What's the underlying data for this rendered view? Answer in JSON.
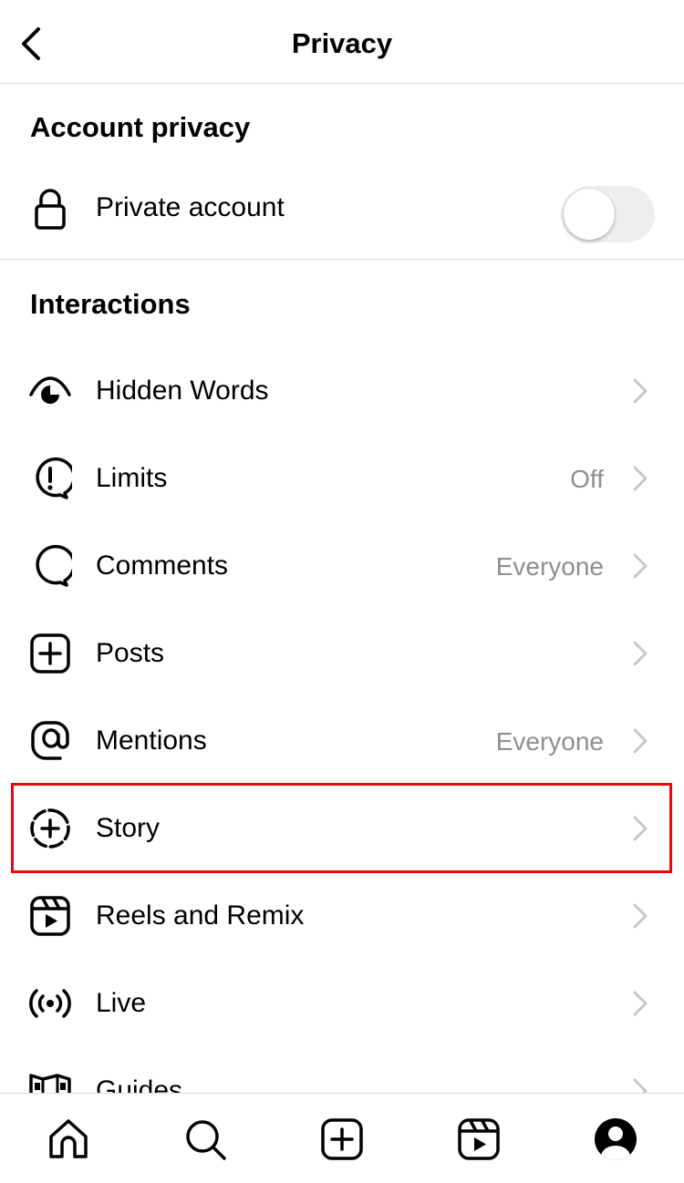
{
  "header": {
    "title": "Privacy",
    "back_icon": "chevron-left-icon"
  },
  "account_privacy": {
    "section_title": "Account privacy",
    "private_account": {
      "label": "Private account",
      "icon": "lock-icon",
      "toggle_on": false
    }
  },
  "interactions": {
    "section_title": "Interactions",
    "items": [
      {
        "label": "Hidden Words",
        "value": "",
        "icon": "eye-icon"
      },
      {
        "label": "Limits",
        "value": "Off",
        "icon": "limits-icon"
      },
      {
        "label": "Comments",
        "value": "Everyone",
        "icon": "comment-icon"
      },
      {
        "label": "Posts",
        "value": "",
        "icon": "plus-square-icon"
      },
      {
        "label": "Mentions",
        "value": "Everyone",
        "icon": "at-sign-icon"
      },
      {
        "label": "Story",
        "value": "",
        "icon": "story-plus-icon"
      },
      {
        "label": "Reels and Remix",
        "value": "",
        "icon": "reels-icon"
      },
      {
        "label": "Live",
        "value": "",
        "icon": "live-icon"
      },
      {
        "label": "Guides",
        "value": "",
        "icon": "guides-icon"
      }
    ]
  },
  "highlight": {
    "target": "Story",
    "color": "#e8080f"
  },
  "tabbar": {
    "items": [
      "home-icon",
      "search-icon",
      "create-icon",
      "reels-tab-icon",
      "profile-icon"
    ]
  }
}
